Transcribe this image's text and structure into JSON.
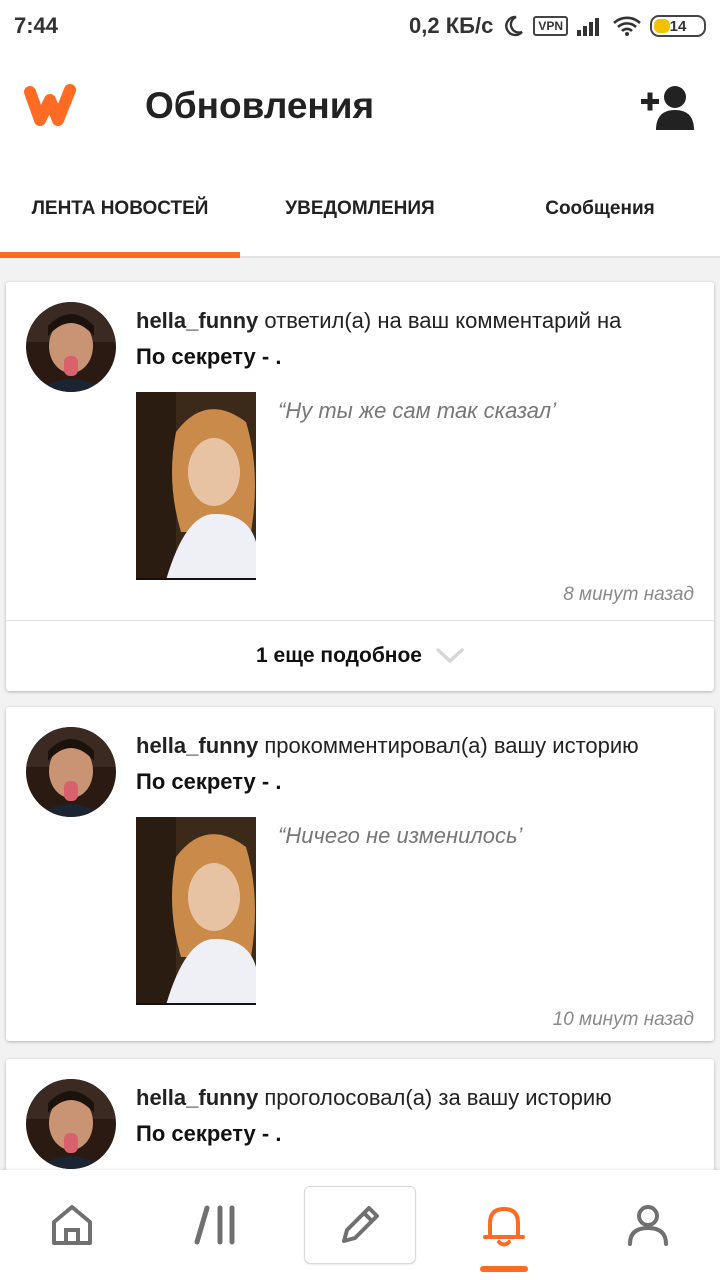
{
  "status_bar": {
    "time": "7:44",
    "speed": "0,2 КБ/с",
    "vpn": "VPN",
    "battery": "14"
  },
  "header": {
    "title": "Обновления"
  },
  "tabs": [
    {
      "label": "ЛЕНТА НОВОСТЕЙ",
      "active": true
    },
    {
      "label": "УВЕДОМЛЕНИЯ",
      "active": false
    },
    {
      "label": "Сообщения",
      "active": false
    }
  ],
  "notifications": [
    {
      "user": "hella_funny",
      "action": "ответил(а) на ваш комментарий на",
      "story": "По секрету - .",
      "quote": "“Ну ты же сам так сказал’",
      "time": "8 минут назад",
      "more_label": "1 еще подобное"
    },
    {
      "user": "hella_funny",
      "action": "прокомментировал(а) вашу историю",
      "story": "По секрету - .",
      "quote": "“Ничего не изменилось’",
      "time": "10 минут назад"
    },
    {
      "user": "hella_funny",
      "action": "проголосовал(а) за вашу историю",
      "story": "По секрету - ."
    }
  ],
  "colors": {
    "accent": "#ff6b23"
  },
  "bottom_nav": [
    "home-icon",
    "library-icon",
    "write-icon",
    "notifications-icon",
    "profile-icon"
  ]
}
